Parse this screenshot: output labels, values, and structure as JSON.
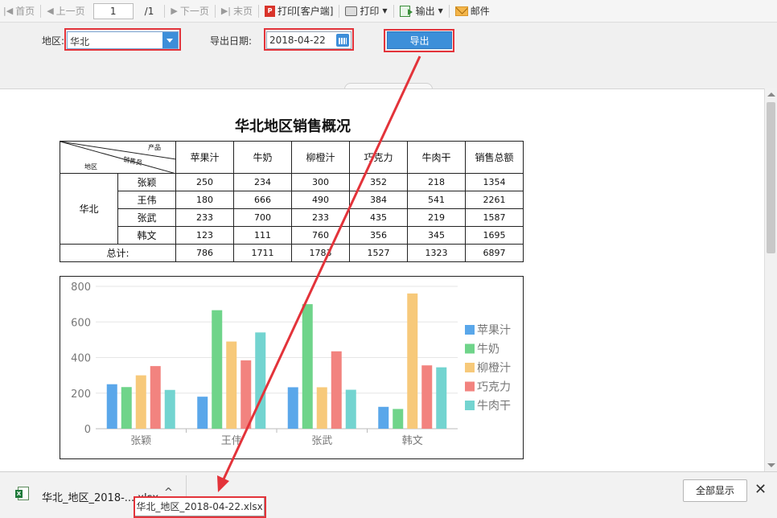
{
  "toolbar": {
    "first": "首页",
    "prev": "上一页",
    "page_value": "1",
    "page_total": "/1",
    "next": "下一页",
    "last": "末页",
    "print_client": "打印[客户端]",
    "print": "打印",
    "export": "输出",
    "mail": "邮件"
  },
  "params": {
    "region_label": "地区:",
    "region_value": "华北",
    "date_label": "导出日期:",
    "date_value": "2018-04-22",
    "export_button": "导出"
  },
  "report": {
    "title": "华北地区销售概况",
    "diag_top": "产品",
    "diag_mid": "销售员",
    "diag_bottom": "地区",
    "columns": [
      "苹果汁",
      "牛奶",
      "柳橙汁",
      "巧克力",
      "牛肉干",
      "销售总额"
    ],
    "region": "华北",
    "rows": [
      {
        "name": "张颖",
        "values": [
          "250",
          "234",
          "300",
          "352",
          "218",
          "1354"
        ]
      },
      {
        "name": "王伟",
        "values": [
          "180",
          "666",
          "490",
          "384",
          "541",
          "2261"
        ]
      },
      {
        "name": "张武",
        "values": [
          "233",
          "700",
          "233",
          "435",
          "219",
          "1587"
        ]
      },
      {
        "name": "韩文",
        "values": [
          "123",
          "111",
          "760",
          "356",
          "345",
          "1695"
        ]
      }
    ],
    "total_label": "总计:",
    "totals": [
      "786",
      "1711",
      "1783",
      "1527",
      "1323",
      "6897"
    ]
  },
  "chart_data": {
    "type": "bar",
    "categories": [
      "张颖",
      "王伟",
      "张武",
      "韩文"
    ],
    "series": [
      {
        "name": "苹果汁",
        "values": [
          250,
          180,
          233,
          123
        ],
        "color": "#5aa7ea"
      },
      {
        "name": "牛奶",
        "values": [
          234,
          666,
          700,
          111
        ],
        "color": "#6fd48a"
      },
      {
        "name": "柳橙汁",
        "values": [
          300,
          490,
          233,
          760
        ],
        "color": "#f7c97a"
      },
      {
        "name": "巧克力",
        "values": [
          352,
          384,
          435,
          356
        ],
        "color": "#f2837f"
      },
      {
        "name": "牛肉干",
        "values": [
          218,
          541,
          219,
          345
        ],
        "color": "#73d4d0"
      }
    ],
    "ylim": [
      0,
      800
    ],
    "yticks": [
      0,
      200,
      400,
      600,
      800
    ],
    "grid": true,
    "legend": "right"
  },
  "download": {
    "file_name": "华北_地区_2018-....xlsx",
    "tooltip": "华北_地区_2018-04-22.xlsx",
    "show_all": "全部显示",
    "close": "✕"
  },
  "icons": {
    "first": "first-page-icon",
    "prev": "prev-page-icon",
    "next": "next-page-icon",
    "last": "last-page-icon",
    "pdf": "pdf-icon",
    "print": "printer-icon",
    "export": "export-icon",
    "mail": "mail-icon",
    "calendar": "calendar-icon",
    "excel": "excel-file-icon"
  },
  "annotation_color": "#e3333a"
}
